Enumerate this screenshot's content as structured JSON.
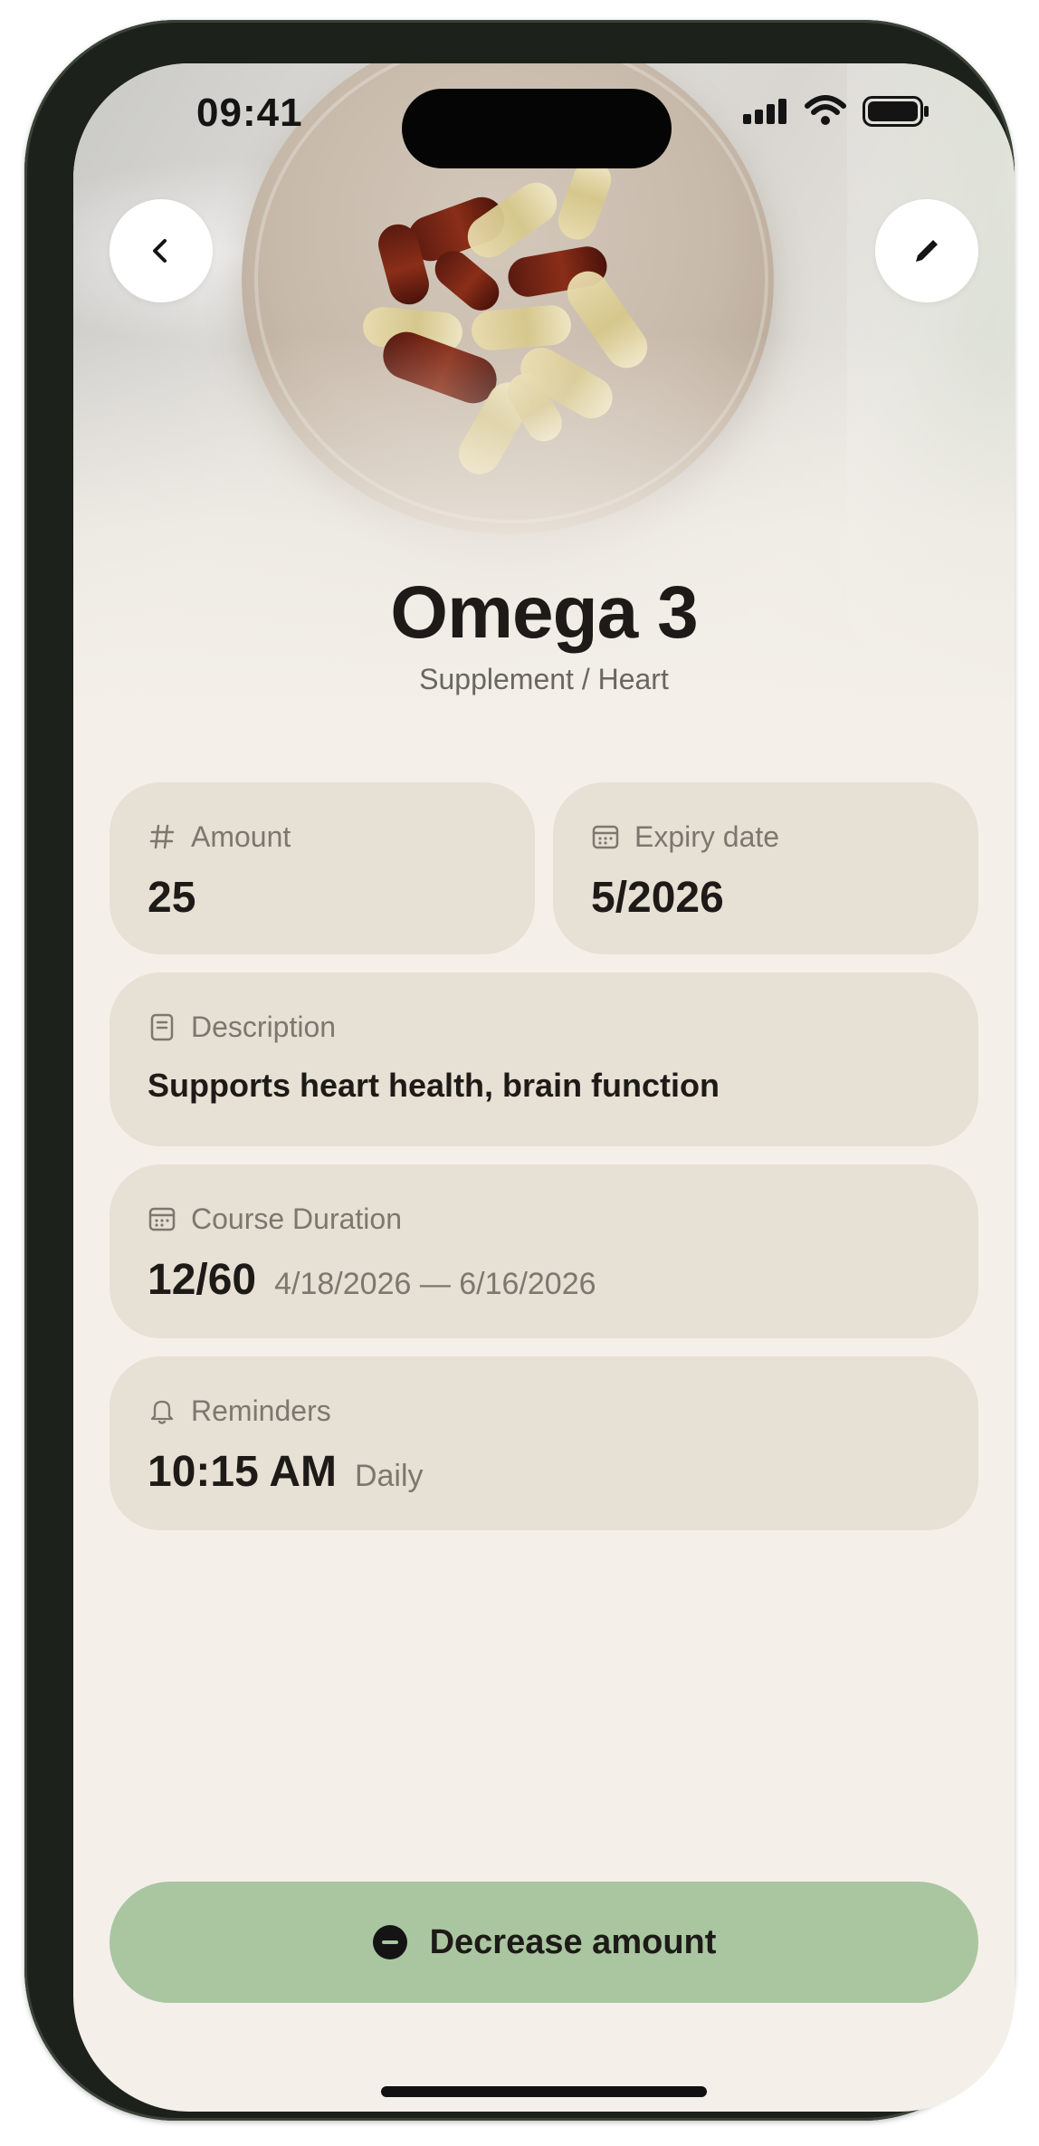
{
  "status_bar": {
    "time": "09:41"
  },
  "header": {
    "title": "Omega 3",
    "subtitle": "Supplement / Heart",
    "back_icon": "chevron-left-icon",
    "edit_icon": "pencil-icon"
  },
  "cards": {
    "amount": {
      "label": "Amount",
      "value": "25",
      "icon": "hash-icon"
    },
    "expiry": {
      "label": "Expiry date",
      "value": "5/2026",
      "icon": "calendar-icon"
    },
    "description": {
      "label": "Description",
      "value": "Supports heart health, brain function",
      "icon": "document-icon"
    },
    "course": {
      "label": "Course Duration",
      "value": "12/60",
      "range": "4/18/2026 — 6/16/2026",
      "icon": "calendar-icon"
    },
    "reminders": {
      "label": "Reminders",
      "time": "10:15 AM",
      "frequency": "Daily",
      "icon": "bell-icon"
    }
  },
  "action": {
    "label": "Decrease amount",
    "icon": "minus-circle-icon"
  },
  "colors": {
    "background": "#f4f0e9",
    "card": "#e7e0d5",
    "accent_button": "#a9c6a0",
    "text_primary": "#1d1a17",
    "text_secondary": "#7d776f"
  }
}
